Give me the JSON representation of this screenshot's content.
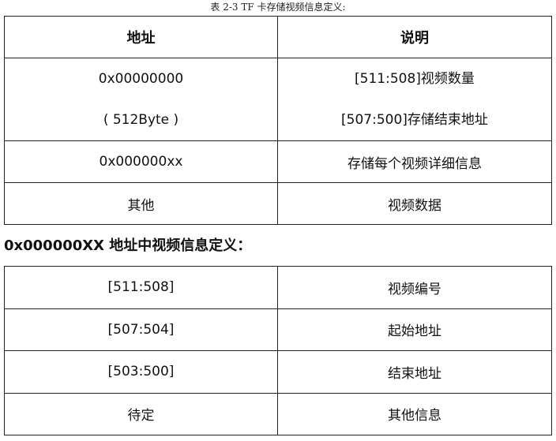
{
  "caption": "表 2-3 TF 卡存储视频信息定义:",
  "table1": {
    "headers": [
      "地址",
      "说明"
    ],
    "row1": {
      "address_lines": [
        "0x00000000",
        "( 512Byte )"
      ],
      "desc_lines": [
        "[511:508]视频数量",
        "[507:500]存储结束地址"
      ]
    },
    "row2": {
      "address": "0x000000xx",
      "desc": "存储每个视频详细信息"
    },
    "row3": {
      "address": "其他",
      "desc": "视频数据"
    }
  },
  "heading": "0x000000XX 地址中视频信息定义：",
  "table2": {
    "rows": [
      {
        "field": "[511:508]",
        "desc": "视频编号"
      },
      {
        "field": "[507:504]",
        "desc": "起始地址"
      },
      {
        "field": "[503:500]",
        "desc": "结束地址"
      },
      {
        "field": "待定",
        "desc": "其他信息"
      }
    ]
  }
}
